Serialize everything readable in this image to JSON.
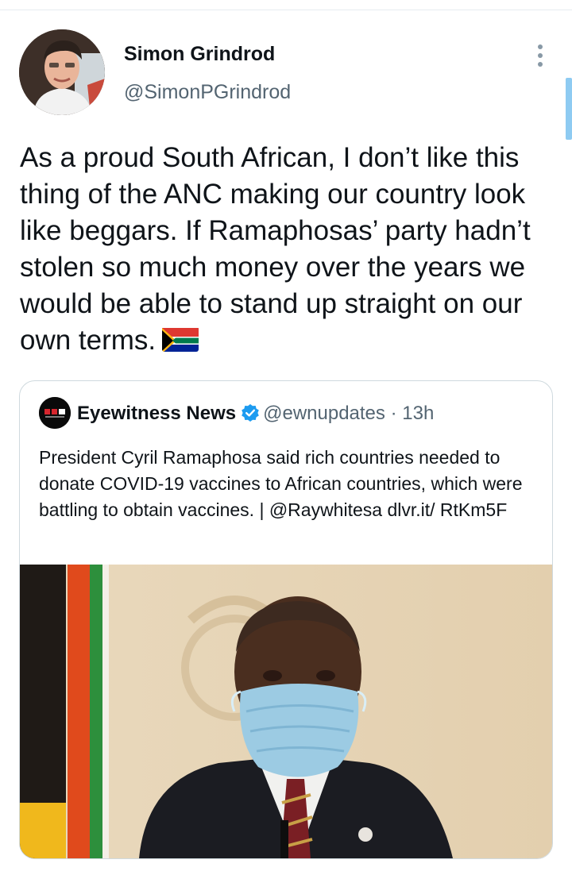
{
  "tweet": {
    "author": {
      "display_name": "Simon Grindrod",
      "handle": "@SimonPGrindrod"
    },
    "text": "As a proud South African, I don’t like this thing of the ANC making our country look like beggars. If Ramaphosas’ party hadn’t stolen so much money over the years we would be able to stand up straight on our own terms.",
    "emoji": "south-africa-flag"
  },
  "quoted_tweet": {
    "author": {
      "display_name": "Eyewitness News",
      "handle": "@ewnupdates",
      "verified": true
    },
    "separator": "·",
    "time": "13h",
    "text": "President Cyril Ramaphosa said rich countries needed to donate COVID-19 vaccines to African countries, which were battling to obtain vaccines. | @Raywhitesa dlvr.it/ RtKm5F",
    "media": "photo-man-in-suit-with-face-mask"
  },
  "icons": {
    "more": "more-vertical-icon",
    "verified": "verified-badge-icon"
  },
  "colors": {
    "text": "#0f1419",
    "secondary": "#536471",
    "verified_blue": "#1d9bf0",
    "border": "#cfd9de"
  }
}
